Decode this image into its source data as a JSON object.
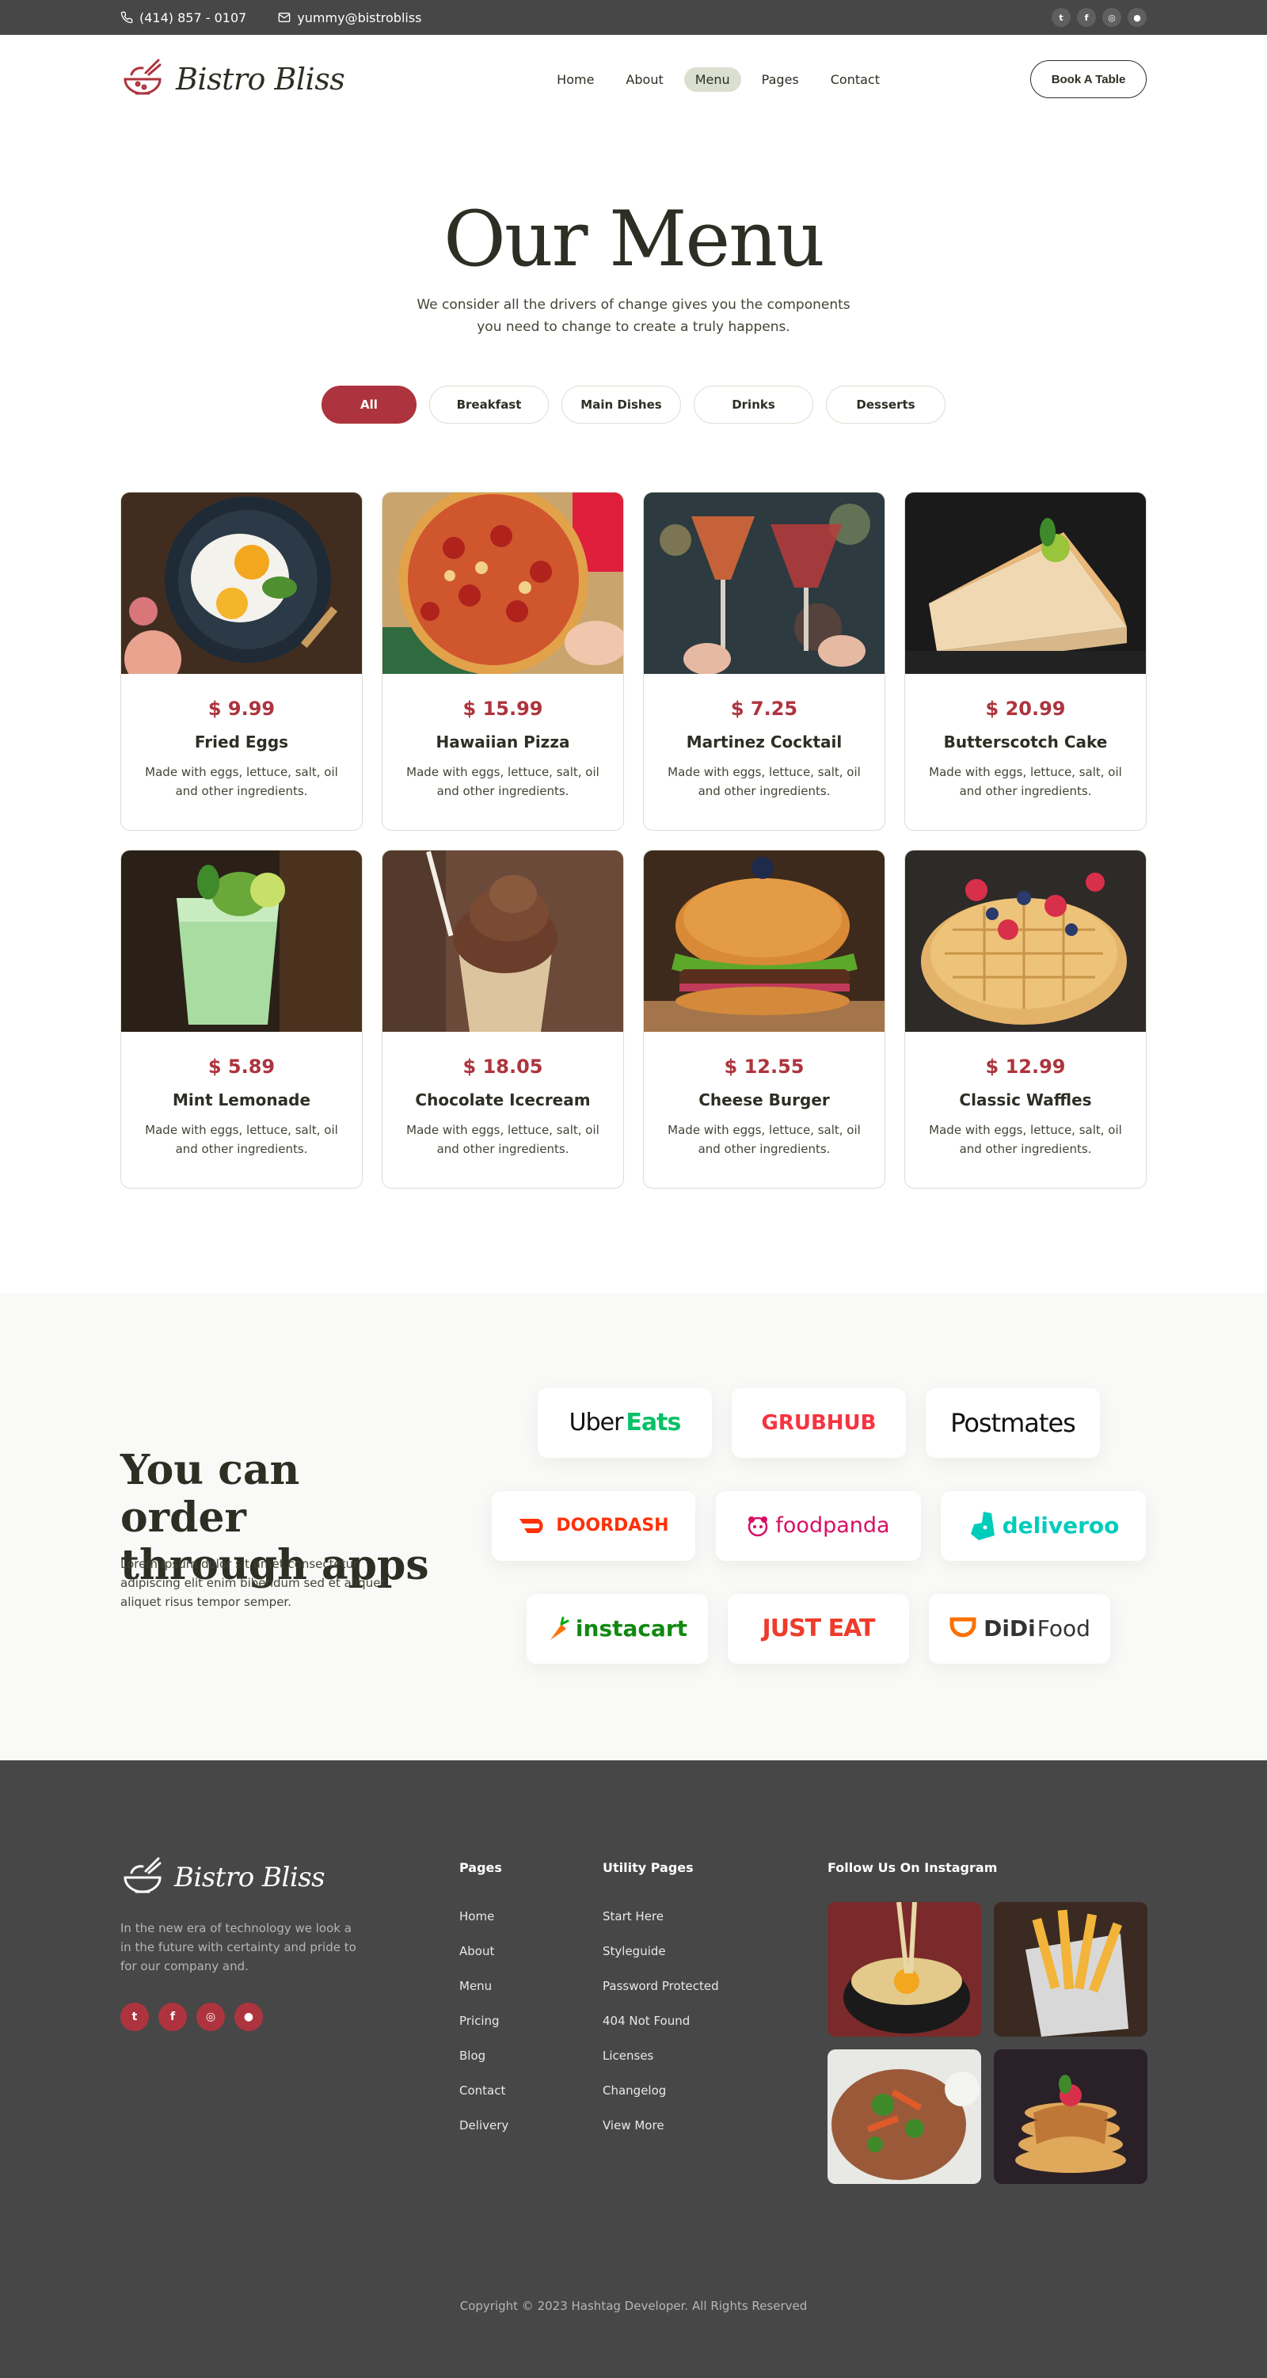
{
  "topbar": {
    "phone": "(414) 857 - 0107",
    "email": "yummy@bistrobliss",
    "socials": [
      "twitter-icon",
      "facebook-icon",
      "instagram-icon",
      "github-icon"
    ]
  },
  "header": {
    "brand": "Bistro Bliss",
    "nav": [
      {
        "label": "Home"
      },
      {
        "label": "About"
      },
      {
        "label": "Menu"
      },
      {
        "label": "Pages"
      },
      {
        "label": "Contact"
      }
    ],
    "cta": "Book A Table"
  },
  "hero": {
    "title": "Our Menu",
    "subtitle": "We consider all the drivers of change gives you the components you need to change to create a truly happens."
  },
  "filters": [
    {
      "label": "All",
      "active": true
    },
    {
      "label": "Breakfast",
      "active": false
    },
    {
      "label": "Main Dishes",
      "active": false
    },
    {
      "label": "Drinks",
      "active": false
    },
    {
      "label": "Desserts",
      "active": false
    }
  ],
  "menu": [
    {
      "price": "$ 9.99",
      "name": "Fried Eggs",
      "desc": "Made with eggs, lettuce, salt, oil and other ingredients."
    },
    {
      "price": "$ 15.99",
      "name": "Hawaiian Pizza",
      "desc": "Made with eggs, lettuce, salt, oil and other ingredients."
    },
    {
      "price": "$ 7.25",
      "name": "Martinez Cocktail",
      "desc": "Made with eggs, lettuce, salt, oil and other ingredients."
    },
    {
      "price": "$ 20.99",
      "name": "Butterscotch Cake",
      "desc": "Made with eggs, lettuce, salt, oil and other ingredients."
    },
    {
      "price": "$ 5.89",
      "name": "Mint Lemonade",
      "desc": "Made with eggs, lettuce, salt, oil and other ingredients."
    },
    {
      "price": "$ 18.05",
      "name": "Chocolate Icecream",
      "desc": "Made with eggs, lettuce, salt, oil and other ingredients."
    },
    {
      "price": "$ 12.55",
      "name": "Cheese Burger",
      "desc": "Made with eggs, lettuce, salt, oil and other ingredients."
    },
    {
      "price": "$ 12.99",
      "name": "Classic Waffles",
      "desc": "Made with eggs, lettuce, salt, oil and other ingredients."
    }
  ],
  "apps": {
    "title": "You can order through apps",
    "text": "Lorem ipsum dolor sit amet consectetur adipiscing elit enim bibendum sed et aliquet aliquet risus tempor semper.",
    "partners": {
      "ubereats_a": "Uber",
      "ubereats_b": "Eats",
      "grubhub": "GRUBHUB",
      "postmates": "Postmates",
      "doordash": "DOORDASH",
      "foodpanda": "foodpanda",
      "deliveroo": "deliveroo",
      "instacart": "instacart",
      "justeat": "JUST EAT",
      "didi_a": "DiDi",
      "didi_b": "Food"
    }
  },
  "footer": {
    "brand": "Bistro Bliss",
    "about": "In the new era of technology we look a in the future with certainty and pride to for our company and.",
    "pages_title": "Pages",
    "pages": [
      "Home",
      "About",
      "Menu",
      "Pricing",
      "Blog",
      "Contact",
      "Delivery"
    ],
    "utility_title": "Utility Pages",
    "utility": [
      "Start Here",
      "Styleguide",
      "Password Protected",
      "404 Not Found",
      "Licenses",
      "Changelog",
      "View More"
    ],
    "instagram_title": "Follow Us On Instagram",
    "copyright": "Copyright © 2023 Hashtag Developer. All Rights Reserved"
  },
  "colors": {
    "accent": "#ad343e",
    "dark": "#474747",
    "text": "#2c2f24",
    "nav_active": "#dbdfd0"
  }
}
